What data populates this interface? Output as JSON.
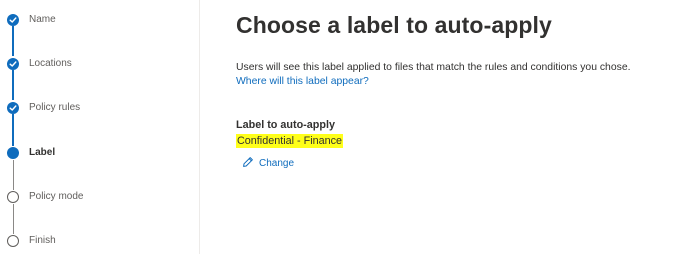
{
  "steps": [
    {
      "label": "Name",
      "state": "done"
    },
    {
      "label": "Locations",
      "state": "done"
    },
    {
      "label": "Policy rules",
      "state": "done"
    },
    {
      "label": "Label",
      "state": "current"
    },
    {
      "label": "Policy mode",
      "state": "todo"
    },
    {
      "label": "Finish",
      "state": "todo"
    }
  ],
  "main": {
    "title": "Choose a label to auto-apply",
    "description": "Users will see this label applied to files that match the rules and conditions you chose.",
    "help_link": "Where will this label appear?",
    "field_label": "Label to auto-apply",
    "field_value": "Confidential - Finance",
    "change_label": "Change"
  },
  "colors": {
    "accent": "#0f6cbd",
    "highlight": "#ffff1a"
  }
}
